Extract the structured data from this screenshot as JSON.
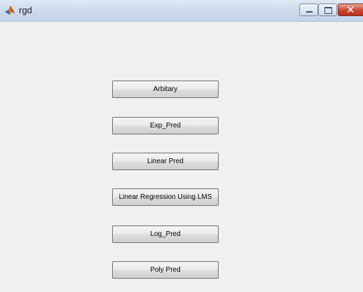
{
  "window": {
    "title": "rgd",
    "icon": "matlab-figure-icon",
    "controls": {
      "minimize": "minimize-icon",
      "maximize": "maximize-icon",
      "close": "close-icon",
      "close_glyph": "✕"
    }
  },
  "buttons": [
    {
      "label": "Arbitary"
    },
    {
      "label": "Exp_Pred"
    },
    {
      "label": "Linear Pred"
    },
    {
      "label": "Linear Regression Using LMS"
    },
    {
      "label": "Log_Pred"
    },
    {
      "label": "Poly Pred"
    }
  ],
  "colors": {
    "background": "#f0f0f0",
    "close_button": "#c9452c"
  }
}
